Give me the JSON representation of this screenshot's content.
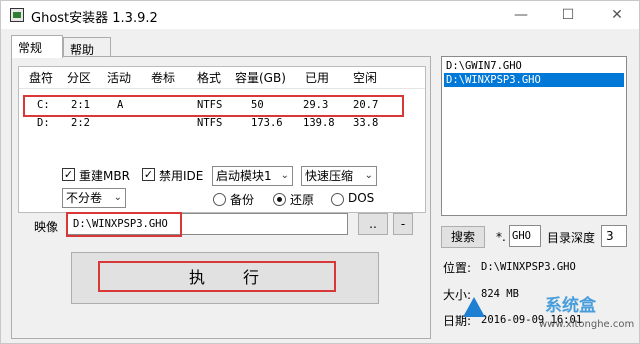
{
  "window": {
    "title": "Ghost安装器 1.3.9.2",
    "controls": {
      "minimize": "—",
      "maximize": "☐",
      "close": "✕"
    }
  },
  "tabs": [
    {
      "label": "常规",
      "active": true
    },
    {
      "label": "帮助",
      "active": false
    }
  ],
  "disk_table": {
    "headers": [
      "盘符",
      "分区",
      "活动",
      "卷标",
      "格式",
      "容量(GB)",
      "已用",
      "空闲"
    ],
    "rows": [
      {
        "drive": "C:",
        "partition": "2:1",
        "active": "A",
        "label": "",
        "format": "NTFS",
        "capacity": "50",
        "used": "29.3",
        "free": "20.7"
      },
      {
        "drive": "D:",
        "partition": "2:2",
        "active": "",
        "label": "",
        "format": "NTFS",
        "capacity": "173.6",
        "used": "139.8",
        "free": "33.8"
      }
    ]
  },
  "options": {
    "rebuild_mbr": {
      "label": "重建MBR",
      "checked": true
    },
    "disable_ide": {
      "label": "禁用IDE",
      "checked": true
    },
    "boot_module": "启动模块1",
    "compression": "快速压缩",
    "split": "不分卷",
    "mode": {
      "backup": "备份",
      "restore": "还原",
      "dos": "DOS",
      "selected": "restore"
    }
  },
  "image": {
    "label": "映像",
    "path": "D:\\WINXPSP3.GHO",
    "browse_label": "..",
    "remove_label": "-"
  },
  "execute_label": "执　　行",
  "file_list": [
    "D:\\GWIN7.GHO",
    "D:\\WINXPSP3.GHO"
  ],
  "search": {
    "button_label": "搜索",
    "ext_prefix": "*.",
    "ext_value": "GHO",
    "depth_label": "目录深度",
    "depth_value": "3"
  },
  "info": {
    "location_label": "位置:",
    "location_value": "D:\\WINXPSP3.GHO",
    "size_label": "大小:",
    "size_value": "824 MB",
    "date_label": "日期:",
    "date_value": "2016-09-09  16:01"
  },
  "watermark": {
    "text": "系统盒",
    "url": "www.xitonghe.com"
  },
  "colors": {
    "highlight_frame": "#d93838",
    "selection": "#0078d7"
  }
}
